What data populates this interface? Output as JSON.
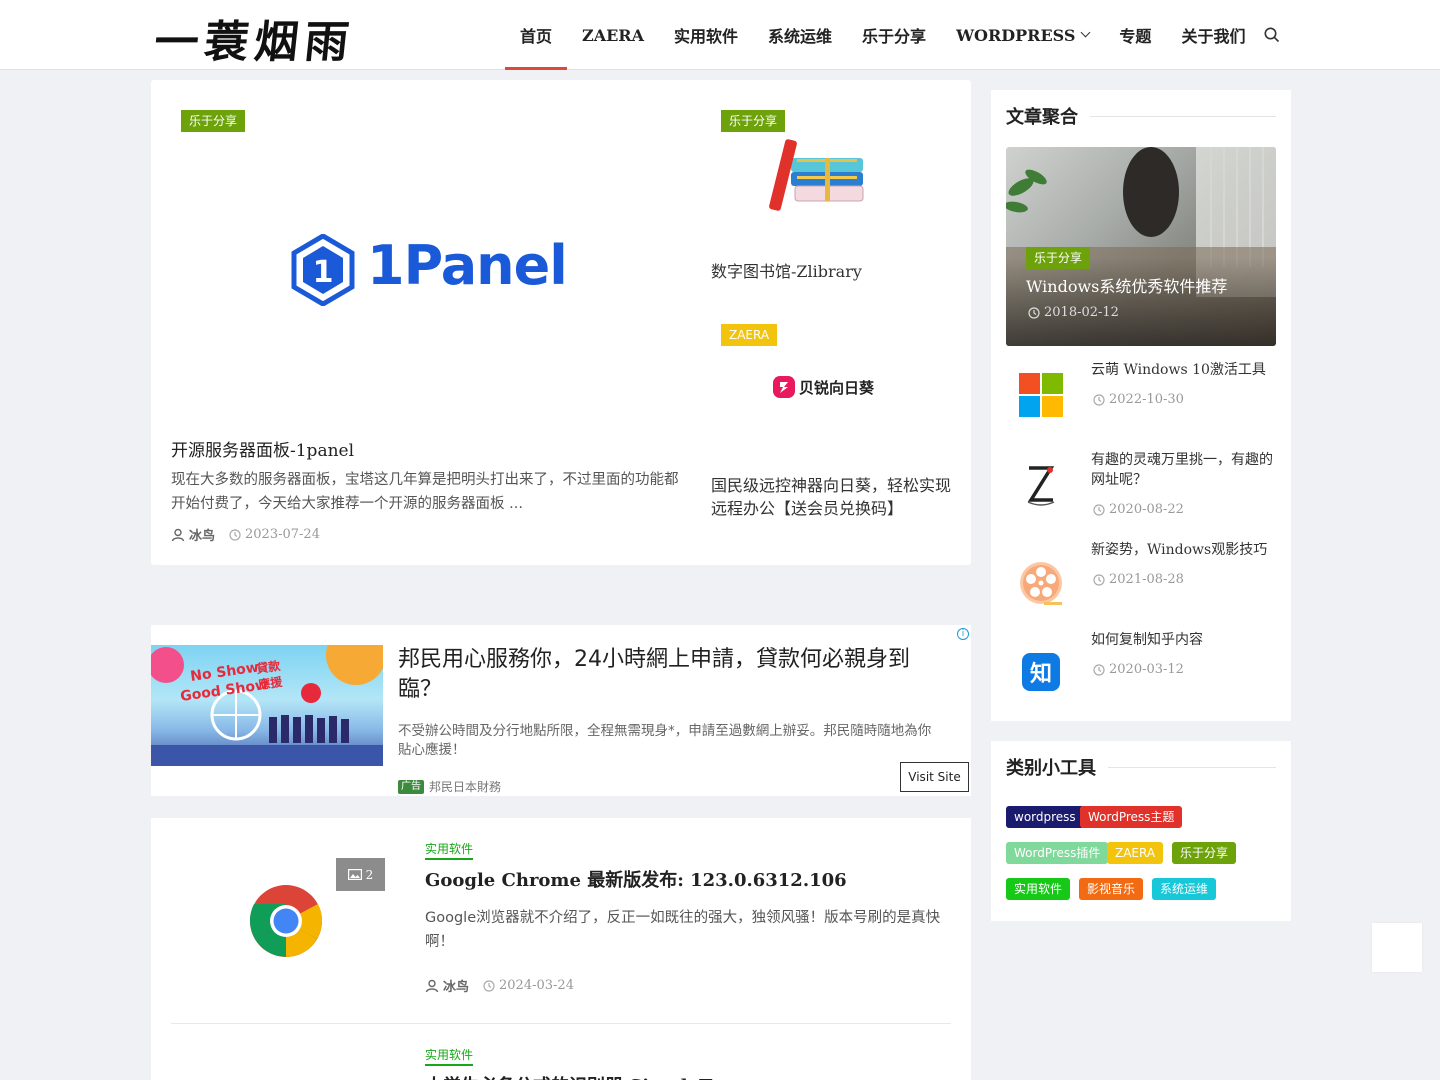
{
  "header": {
    "logo": "一蓑烟雨",
    "nav": [
      {
        "label": "首页",
        "active": true
      },
      {
        "label": "ZAERA"
      },
      {
        "label": "实用软件"
      },
      {
        "label": "系统运维"
      },
      {
        "label": "乐于分享"
      },
      {
        "label": "WORDPRESS",
        "has_dropdown": true
      },
      {
        "label": "专题"
      },
      {
        "label": "关于我们"
      }
    ]
  },
  "featured": {
    "main": {
      "tag": "乐于分享",
      "logo_text": "1Panel",
      "title": "开源服务器面板-1panel",
      "excerpt": "现在大多数的服务器面板，宝塔这几年算是把明头打出来了，不过里面的功能都开始付费了，今天给大家推荐一个开源的服务器面板 ...",
      "author": "冰鸟",
      "date": "2023-07-24"
    },
    "side": [
      {
        "tag": "乐于分享",
        "title": "数字图书馆-Zlibrary"
      },
      {
        "tag": "ZAERA",
        "brand": "贝锐向日葵",
        "title": "国民级远控神器向日葵，轻松实现远程办公【送会员兑换码】"
      }
    ]
  },
  "ad": {
    "image_text_1": "No Show",
    "image_text_2": "貸款",
    "image_text_3": "Good Show",
    "image_text_4": "應援",
    "headline": "邦民用心服務你，24小時網上申請，貸款何必親身到臨？",
    "body": "不受辦公時間及分行地點所限，全程無需現身*，申請至過數網上辦妥。邦民隨時隨地為你貼心應援！",
    "badge": "广告",
    "advertiser": "邦民日本財務",
    "cta": "Visit Site"
  },
  "list": [
    {
      "tag": "实用软件",
      "image_count": "2",
      "title": "Google Chrome 最新版发布: 123.0.6312.106",
      "excerpt": "Google浏览器就不介绍了，反正一如既往的强大，独领风骚！版本号刷的是真快啊！",
      "author": "冰鸟",
      "date": "2024-03-24"
    },
    {
      "tag": "实用软件",
      "title": "大学生必备公式的识别器 SimpleTex"
    }
  ],
  "sidebar": {
    "aggregate": {
      "title": "文章聚合",
      "hero": {
        "tag": "乐于分享",
        "title": "Windows系统优秀软件推荐",
        "date": "2018-02-12"
      },
      "posts": [
        {
          "title": "云萌 Windows 10激活工具",
          "date": "2022-10-30",
          "icon": "windows-logo-icon"
        },
        {
          "title": "有趣的灵魂万里挑一，有趣的网址呢？",
          "date": "2020-08-22",
          "icon": "z-logo-icon"
        },
        {
          "title": "新姿势，Windows观影技巧",
          "date": "2021-08-28",
          "icon": "film-reel-icon"
        },
        {
          "title": "如何复制知乎内容",
          "date": "2020-03-12",
          "icon": "zhihu-logo-icon"
        }
      ]
    },
    "categories": {
      "title": "类别小工具",
      "chips": [
        {
          "label": "wordpress",
          "color": "#1a1a6e"
        },
        {
          "label": "WordPress主题",
          "color": "#e0312b"
        },
        {
          "label": "WordPress插件",
          "color": "#7fd99a"
        },
        {
          "label": "ZAERA",
          "color": "#f2c40e"
        },
        {
          "label": "乐于分享",
          "color": "#6ea20b"
        },
        {
          "label": "实用软件",
          "color": "#16c916"
        },
        {
          "label": "影视音乐",
          "color": "#f26a12"
        },
        {
          "label": "系统运维",
          "color": "#17c8d8"
        }
      ]
    }
  }
}
